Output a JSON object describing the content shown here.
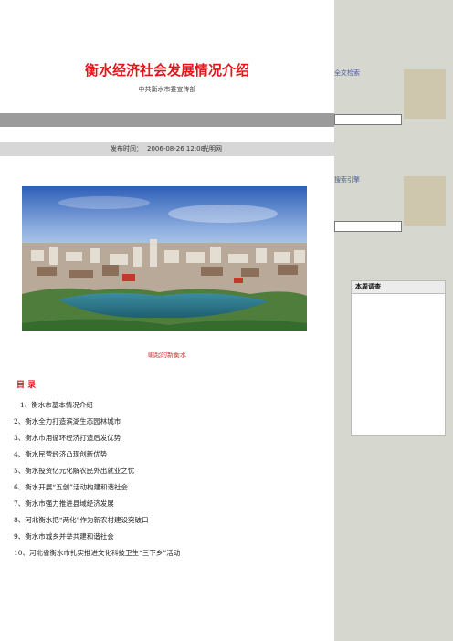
{
  "article": {
    "title": "衡水经济社会发展情况介绍",
    "source": "中共衡水市委宣传部",
    "published_label": "发布时间：",
    "published_time": "2006-08-26 12:08",
    "publisher": "光明网",
    "photo_caption": "崛起的新衡水"
  },
  "toc": {
    "heading": "目 录",
    "items": [
      "1、衡水市基本情况介绍",
      "2、衡水全力打造滨湖生态园林城市",
      "3、衡水市用循环经济打造后发优势",
      "4、衡水民营经济凸现创新优势",
      "5、衡水投资亿元化解农民外出就业之忧",
      "6、衡水开展“五创”活动构建和谐社会",
      "7、衡水市强力推进县域经济发展",
      "8、河北衡水把“两化”作为新农村建设突破口",
      "9、衡水市城乡并举共建和谐社会",
      "10、河北省衡水市扎实推进文化科技卫生“三下乡”活动"
    ]
  },
  "sidebar": {
    "fulltext_label": "全文检索",
    "engine_label": "搜索引擎",
    "poll_title": "本周调查"
  },
  "colors": {
    "title_red": "#e4141b",
    "sidebar_bg": "#d6d7cf",
    "grey_bar": "#9b9b9b"
  }
}
